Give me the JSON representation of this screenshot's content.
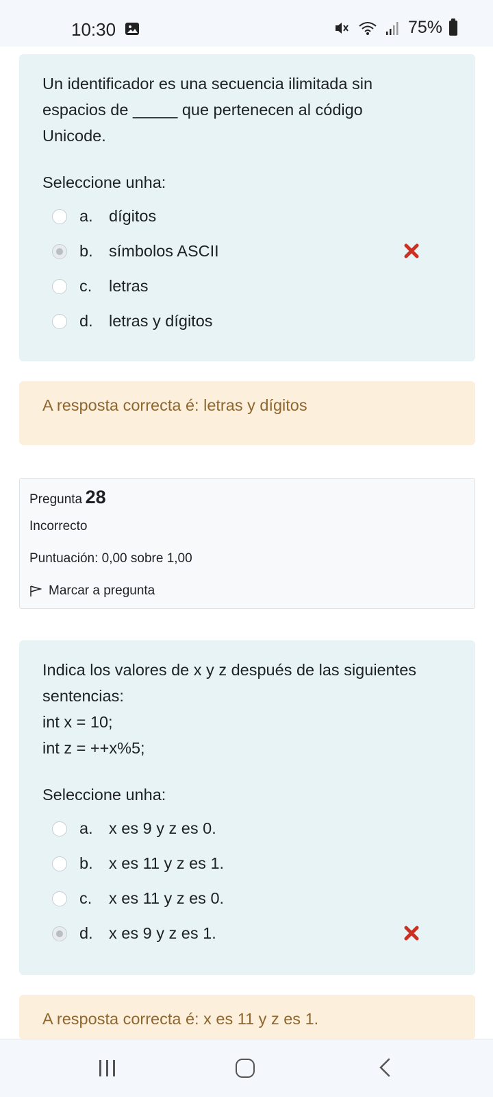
{
  "status_bar": {
    "time": "10:30",
    "battery": "75%",
    "icons": [
      "gallery-icon",
      "mute-icon",
      "wifi-icon",
      "signal-icon",
      "battery-icon"
    ]
  },
  "q1": {
    "text_lines": [
      "Un identificador es una secuencia ilimitada sin",
      "espacios de _____ que pertenecen al código",
      "Unicode."
    ],
    "prompt": "Seleccione unha:",
    "options": [
      {
        "letter": "a.",
        "text": "dígitos",
        "selected": false
      },
      {
        "letter": "b.",
        "text": "símbolos ASCII",
        "selected": true,
        "marked_incorrect": true
      },
      {
        "letter": "c.",
        "text": "letras",
        "selected": false
      },
      {
        "letter": "d.",
        "text": "letras y dígitos",
        "selected": false
      }
    ],
    "feedback": "A resposta correcta é: letras y dígitos"
  },
  "q28_info": {
    "label": "Pregunta",
    "number": "28",
    "state": "Incorrecto",
    "grade": "Puntuación: 0,00 sobre 1,00",
    "flag_label": "Marcar a pregunta"
  },
  "q28": {
    "text_lines": [
      "Indica los valores de x y z después de las siguientes",
      "sentencias:",
      "int x = 10;",
      "int z = ++x%5;"
    ],
    "prompt": "Seleccione unha:",
    "options": [
      {
        "letter": "a.",
        "text": "x es 9 y z es 0.",
        "selected": false
      },
      {
        "letter": "b.",
        "text": "x es 11 y z es 1.",
        "selected": false
      },
      {
        "letter": "c.",
        "text": "x es 11 y z es 0.",
        "selected": false
      },
      {
        "letter": "d.",
        "text": "x es 9 y z es 1.",
        "selected": true,
        "marked_incorrect": true
      }
    ],
    "feedback": "A resposta correcta é: x es 11 y z es 1."
  },
  "colors": {
    "question_bg": "#e7f3f5",
    "feedback_bg": "#fcefdc",
    "feedback_text": "#8e662e",
    "incorrect_icon": "#ca3120"
  }
}
